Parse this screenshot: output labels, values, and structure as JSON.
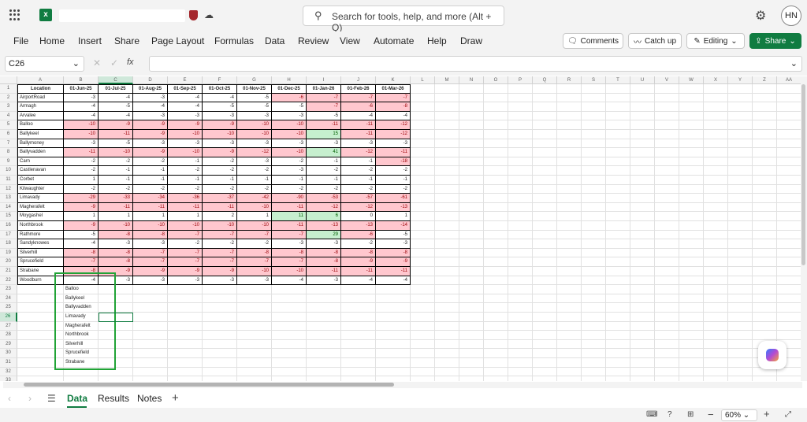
{
  "app": {
    "user_initials": "HN",
    "search_placeholder": "Search for tools, help, and more (Alt + Q)"
  },
  "menu": [
    "File",
    "Home",
    "Insert",
    "Share",
    "Page Layout",
    "Formulas",
    "Data",
    "Review",
    "View",
    "Automate",
    "Help",
    "Draw"
  ],
  "buttons": {
    "comments": "Comments",
    "catchup": "Catch up",
    "editing": "Editing",
    "share": "Share"
  },
  "formula_bar": {
    "name_box": "C26",
    "fx": "fx",
    "value": ""
  },
  "columns": [
    "A",
    "B",
    "C",
    "D",
    "E",
    "F",
    "G",
    "H",
    "I",
    "J",
    "K",
    "L",
    "M",
    "N",
    "O",
    "P",
    "Q",
    "R",
    "S",
    "T",
    "U",
    "V",
    "W",
    "X",
    "Y",
    "Z",
    "AA"
  ],
  "table": {
    "headers": [
      "Location",
      "01-Jun-25",
      "01-Jul-25",
      "01-Aug-25",
      "01-Sep-25",
      "01-Oct-25",
      "01-Nov-25",
      "01-Dec-25",
      "01-Jan-26",
      "01-Feb-26",
      "01-Mar-26"
    ],
    "rows": [
      {
        "loc": "AirportRoad",
        "v": [
          -3,
          -4,
          -3,
          -4,
          -4,
          -5,
          -6,
          -7,
          -7,
          -7
        ],
        "hl": [
          "",
          "",
          "",
          "",
          "",
          "",
          "r",
          "r",
          "r",
          "r"
        ]
      },
      {
        "loc": "Armagh",
        "v": [
          -4,
          -5,
          -4,
          -4,
          -5,
          -5,
          -5,
          -7,
          -6,
          -8
        ],
        "hl": [
          "",
          "",
          "",
          "",
          "",
          "",
          "",
          "r",
          "r",
          "r"
        ]
      },
      {
        "loc": "Arvalee",
        "v": [
          -4,
          -4,
          -3,
          -3,
          -3,
          -3,
          -3,
          -5,
          -4,
          -4
        ],
        "hl": [
          "",
          "",
          "",
          "",
          "",
          "",
          "",
          "",
          "",
          ""
        ]
      },
      {
        "loc": "Balloo",
        "v": [
          -10,
          -9,
          -9,
          -9,
          -9,
          -10,
          -10,
          -11,
          -11,
          -12
        ],
        "hl": [
          "r",
          "r",
          "r",
          "r",
          "r",
          "r",
          "r",
          "r",
          "r",
          "r"
        ]
      },
      {
        "loc": "Ballykeel",
        "v": [
          -10,
          -11,
          -9,
          -10,
          -10,
          -10,
          -10,
          15,
          -11,
          -12
        ],
        "hl": [
          "r",
          "r",
          "r",
          "r",
          "r",
          "r",
          "r",
          "g",
          "r",
          "r"
        ]
      },
      {
        "loc": "Ballymoney",
        "v": [
          -3,
          -5,
          -3,
          -3,
          -3,
          -3,
          -3,
          -3,
          -3,
          -3
        ],
        "hl": [
          "",
          "",
          "",
          "",
          "",
          "",
          "",
          "",
          "",
          ""
        ]
      },
      {
        "loc": "Ballyvadden",
        "v": [
          -11,
          -10,
          -9,
          -10,
          -9,
          -12,
          -10,
          41,
          -12,
          -11
        ],
        "hl": [
          "r",
          "r",
          "r",
          "r",
          "r",
          "r",
          "r",
          "g",
          "r",
          "r"
        ]
      },
      {
        "loc": "Carn",
        "v": [
          -2,
          -2,
          -2,
          -1,
          -2,
          -3,
          -2,
          -1,
          -1,
          -18
        ],
        "hl": [
          "",
          "",
          "",
          "",
          "",
          "",
          "",
          "",
          "",
          "r"
        ]
      },
      {
        "loc": "Castlenavan",
        "v": [
          -2,
          -1,
          -1,
          -2,
          -2,
          -2,
          -3,
          -2,
          -2,
          -2
        ],
        "hl": [
          "",
          "",
          "",
          "",
          "",
          "",
          "",
          "",
          "",
          ""
        ]
      },
      {
        "loc": "Corbet",
        "v": [
          1,
          -1,
          -1,
          -1,
          -1,
          -1,
          -1,
          -1,
          -1,
          -1
        ],
        "hl": [
          "",
          "",
          "",
          "",
          "",
          "",
          "",
          "",
          "",
          ""
        ]
      },
      {
        "loc": "Kilwaughter",
        "v": [
          -2,
          -2,
          -2,
          -2,
          -2,
          -2,
          -2,
          -2,
          -2,
          -2
        ],
        "hl": [
          "",
          "",
          "",
          "",
          "",
          "",
          "",
          "",
          "",
          ""
        ]
      },
      {
        "loc": "Limavady",
        "v": [
          -29,
          -33,
          -34,
          -36,
          -37,
          -42,
          -90,
          -53,
          -57,
          -61
        ],
        "hl": [
          "r",
          "r",
          "r",
          "r",
          "r",
          "r",
          "r",
          "r",
          "r",
          "r"
        ]
      },
      {
        "loc": "Magherafelt",
        "v": [
          -9,
          -11,
          -11,
          -11,
          -11,
          -10,
          -11,
          -12,
          -12,
          -13
        ],
        "hl": [
          "r",
          "r",
          "r",
          "r",
          "r",
          "r",
          "r",
          "r",
          "r",
          "r"
        ]
      },
      {
        "loc": "Moygashel",
        "v": [
          1,
          1,
          1,
          1,
          2,
          1,
          11,
          6,
          0,
          1
        ],
        "hl": [
          "",
          "",
          "",
          "",
          "",
          "",
          "g",
          "g",
          "",
          ""
        ]
      },
      {
        "loc": "Northbrook",
        "v": [
          -9,
          -10,
          -10,
          -10,
          -10,
          -10,
          -11,
          -13,
          -13,
          -14
        ],
        "hl": [
          "r",
          "r",
          "r",
          "r",
          "r",
          "r",
          "r",
          "r",
          "r",
          "r"
        ]
      },
      {
        "loc": "Rathmore",
        "v": [
          -5,
          -8,
          -8,
          -7,
          -7,
          -7,
          -7,
          29,
          -6,
          -5
        ],
        "hl": [
          "",
          "r",
          "r",
          "r",
          "r",
          "r",
          "r",
          "g",
          "r",
          ""
        ]
      },
      {
        "loc": "Sandyknowes",
        "v": [
          -4,
          -3,
          -3,
          -2,
          -2,
          -2,
          -3,
          -3,
          -2,
          -3
        ],
        "hl": [
          "",
          "",
          "",
          "",
          "",
          "",
          "",
          "",
          "",
          ""
        ]
      },
      {
        "loc": "Silverhill",
        "v": [
          -8,
          -8,
          -7,
          -7,
          -7,
          -8,
          -8,
          -8,
          -8,
          -8
        ],
        "hl": [
          "r",
          "r",
          "r",
          "r",
          "r",
          "r",
          "r",
          "r",
          "r",
          "r"
        ]
      },
      {
        "loc": "Sprucefield",
        "v": [
          -7,
          -8,
          -7,
          -7,
          -7,
          -7,
          -7,
          -8,
          -9,
          -9
        ],
        "hl": [
          "r",
          "r",
          "r",
          "r",
          "r",
          "r",
          "r",
          "r",
          "r",
          "r"
        ]
      },
      {
        "loc": "Strabane",
        "v": [
          -8,
          -9,
          -9,
          -9,
          -9,
          -10,
          -10,
          -11,
          -11,
          -11
        ],
        "hl": [
          "r",
          "r",
          "r",
          "r",
          "r",
          "r",
          "r",
          "r",
          "r",
          "r"
        ]
      },
      {
        "loc": "Woodburn",
        "v": [
          -4,
          -3,
          -3,
          -3,
          -3,
          -3,
          -4,
          -3,
          -4,
          -4
        ],
        "hl": [
          "",
          "",
          "",
          "",
          "",
          "",
          "",
          "",
          "",
          ""
        ]
      }
    ]
  },
  "list": [
    "Balloo",
    "Ballykeel",
    "Ballyvadden",
    "Limavady",
    "Magherafelt",
    "Northbrook",
    "Silverhill",
    "Sprucefield",
    "Strabane"
  ],
  "sheets": [
    "Data",
    "Results",
    "Notes"
  ],
  "status": {
    "zoom": "60%"
  }
}
